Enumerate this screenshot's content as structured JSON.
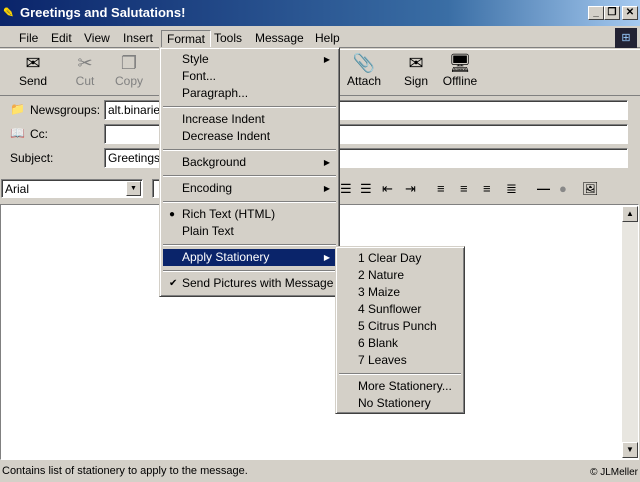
{
  "window": {
    "title": "Greetings and Salutations!",
    "min": "_",
    "max": "❐",
    "close": "✕"
  },
  "menubar": [
    "File",
    "Edit",
    "View",
    "Insert",
    "Format",
    "Tools",
    "Message",
    "Help"
  ],
  "toolbar": [
    {
      "label": "Send",
      "icon": "✉",
      "disabled": false
    },
    {
      "label": "Cut",
      "icon": "✂",
      "disabled": true
    },
    {
      "label": "Copy",
      "icon": "❐",
      "disabled": true
    },
    {
      "label": "Attach",
      "icon": "📎",
      "disabled": false
    },
    {
      "label": "Sign",
      "icon": "✉",
      "disabled": false
    },
    {
      "label": "Offline",
      "icon": "🖥",
      "disabled": false
    }
  ],
  "header": {
    "newsgroups_label": "Newsgroups:",
    "newsgroups_value": "alt.binaries",
    "cc_label": "Cc:",
    "cc_value": "",
    "subject_label": "Subject:",
    "subject_value": "Greetings a"
  },
  "format_bar": {
    "font": "Arial"
  },
  "format_menu": [
    {
      "label": "Style",
      "submenu": true
    },
    {
      "label": "Font..."
    },
    {
      "label": "Paragraph..."
    },
    {
      "sep": true
    },
    {
      "label": "Increase Indent"
    },
    {
      "label": "Decrease Indent"
    },
    {
      "sep": true
    },
    {
      "label": "Background",
      "submenu": true
    },
    {
      "sep": true
    },
    {
      "label": "Encoding",
      "submenu": true
    },
    {
      "sep": true
    },
    {
      "label": "Rich Text (HTML)",
      "radio": true
    },
    {
      "label": "Plain Text"
    },
    {
      "sep": true
    },
    {
      "label": "Apply Stationery",
      "submenu": true,
      "highlighted": true
    },
    {
      "sep": true
    },
    {
      "label": "Send Pictures with Message",
      "checked": true
    }
  ],
  "stationery_menu": [
    "1 Clear Day",
    "2 Nature",
    "3 Maize",
    "4 Sunflower",
    "5 Citrus Punch",
    "6 Blank",
    "7 Leaves",
    null,
    "More Stationery...",
    "No Stationery"
  ],
  "status": {
    "text": "Contains list of stationery to apply to the message.",
    "credit": "© JLMeller"
  },
  "colors": {
    "titlebar": "#0a246a",
    "highlight": "#0a246a",
    "face": "#d4d0c8"
  }
}
